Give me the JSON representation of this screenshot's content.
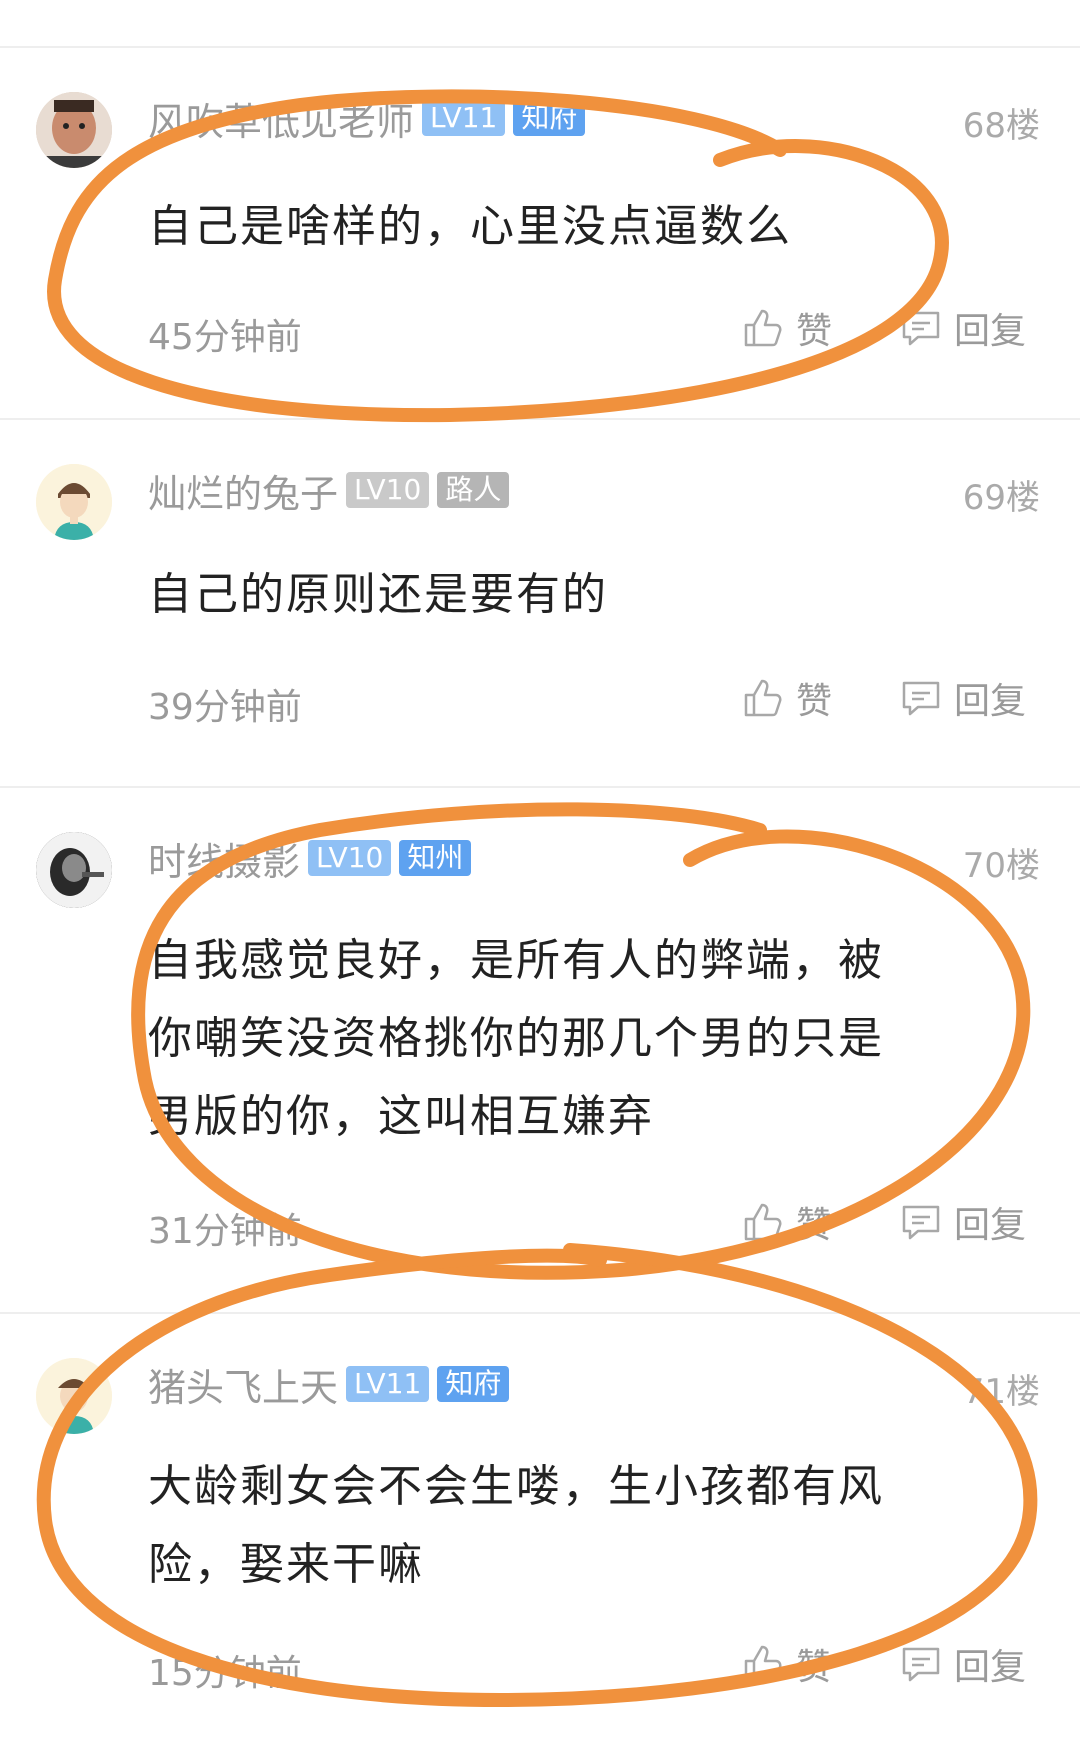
{
  "posts": [
    {
      "username": "风吹草低见老师",
      "level": "LV11",
      "title": "知府",
      "title_color": "#5ea2f0",
      "level_color": "#8fc0f5",
      "floor": "68楼",
      "content": "自己是啥样的，心里没点逼数么",
      "time": "45分钟前",
      "like_label": "赞",
      "reply_label": "回复"
    },
    {
      "username": "灿烂的兔子",
      "level": "LV10",
      "title": "路人",
      "title_color": "#b5b5b5",
      "level_color": "#c9c9c9",
      "floor": "69楼",
      "content": "自己的原则还是要有的",
      "time": "39分钟前",
      "like_label": "赞",
      "reply_label": "回复"
    },
    {
      "username": "时线摄影",
      "level": "LV10",
      "title": "知州",
      "title_color": "#5ea2f0",
      "level_color": "#8fc0f5",
      "floor": "70楼",
      "content_lines": [
        "自我感觉良好，是所有人的弊端，被",
        "你嘲笑没资格挑你的那几个男的只是",
        "男版的你，这叫相互嫌弃"
      ],
      "time": "31分钟前",
      "like_label": "赞",
      "reply_label": "回复"
    },
    {
      "username": "猪头飞上天",
      "level": "LV11",
      "title": "知府",
      "title_color": "#5ea2f0",
      "level_color": "#8fc0f5",
      "floor": "71楼",
      "content_lines": [
        "大龄剩女会不会生喽，生小孩都有风",
        "险，娶来干嘛"
      ],
      "time": "15分钟前",
      "like_label": "赞",
      "reply_label": "回复"
    }
  ],
  "icons": {
    "like": "thumbs-up-icon",
    "reply": "comment-bubble-icon"
  },
  "colors": {
    "annotation": "#f0913d"
  }
}
